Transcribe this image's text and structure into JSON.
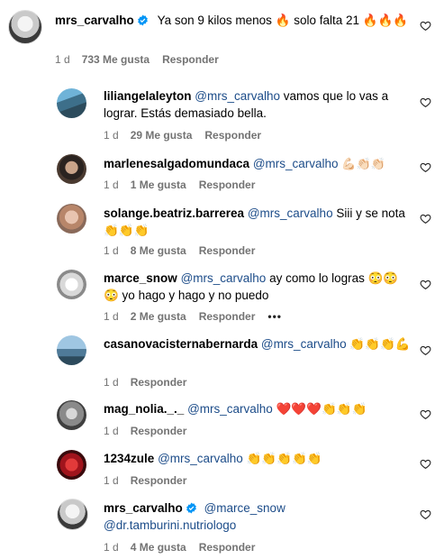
{
  "comments": [
    {
      "user": "mrs_carvalho",
      "verified": true,
      "mention": "",
      "text": "Ya son 9 kilos menos 🔥 solo falta 21 🔥🔥🔥",
      "time": "1 d",
      "likes": "733 Me gusta",
      "reply": "Responder"
    },
    {
      "user": "liliangelaleyton",
      "mention": "@mrs_carvalho",
      "text": "vamos que lo vas a lograr. Estás demasiado bella.",
      "time": "1 d",
      "likes": "29 Me gusta",
      "reply": "Responder"
    },
    {
      "user": "marlenesalgadomundaca",
      "mention": "@mrs_carvalho",
      "text": "💪🏻👏🏻👏🏻",
      "time": "1 d",
      "likes": "1 Me gusta",
      "reply": "Responder"
    },
    {
      "user": "solange.beatriz.barrerea",
      "mention": "@mrs_carvalho",
      "text": "Siii y se nota 👏👏👏",
      "time": "1 d",
      "likes": "8 Me gusta",
      "reply": "Responder"
    },
    {
      "user": "marce_snow",
      "mention": "@mrs_carvalho",
      "text": "ay como lo logras 😳😳😳 yo hago y hago y no puedo",
      "time": "1 d",
      "likes": "2 Me gusta",
      "reply": "Responder",
      "more": "•••"
    },
    {
      "user": "casanovacisternabernarda",
      "mention": "@mrs_carvalho",
      "text": "👏👏👏💪",
      "time": "1 d",
      "likes": "",
      "reply": "Responder"
    },
    {
      "user": "mag_nolia._._",
      "mention": "@mrs_carvalho",
      "text": "❤️❤️❤️👏👏👏",
      "time": "1 d",
      "likes": "",
      "reply": "Responder"
    },
    {
      "user": "1234zule",
      "mention": "@mrs_carvalho",
      "text": "👏👏👏👏👏",
      "time": "1 d",
      "likes": "",
      "reply": "Responder"
    },
    {
      "user": "mrs_carvalho",
      "verified": true,
      "mention": "@marce_snow",
      "mention2": "@dr.tamburini.nutriologo",
      "text": "",
      "time": "1 d",
      "likes": "4 Me gusta",
      "reply": "Responder"
    }
  ],
  "colors": {
    "mention": "#1c4c89",
    "verified": "#0095f6",
    "meta": "#737373"
  },
  "icons": {
    "like": "heart-outline-icon",
    "verified": "verified-badge-icon",
    "more": "more-options-icon"
  }
}
